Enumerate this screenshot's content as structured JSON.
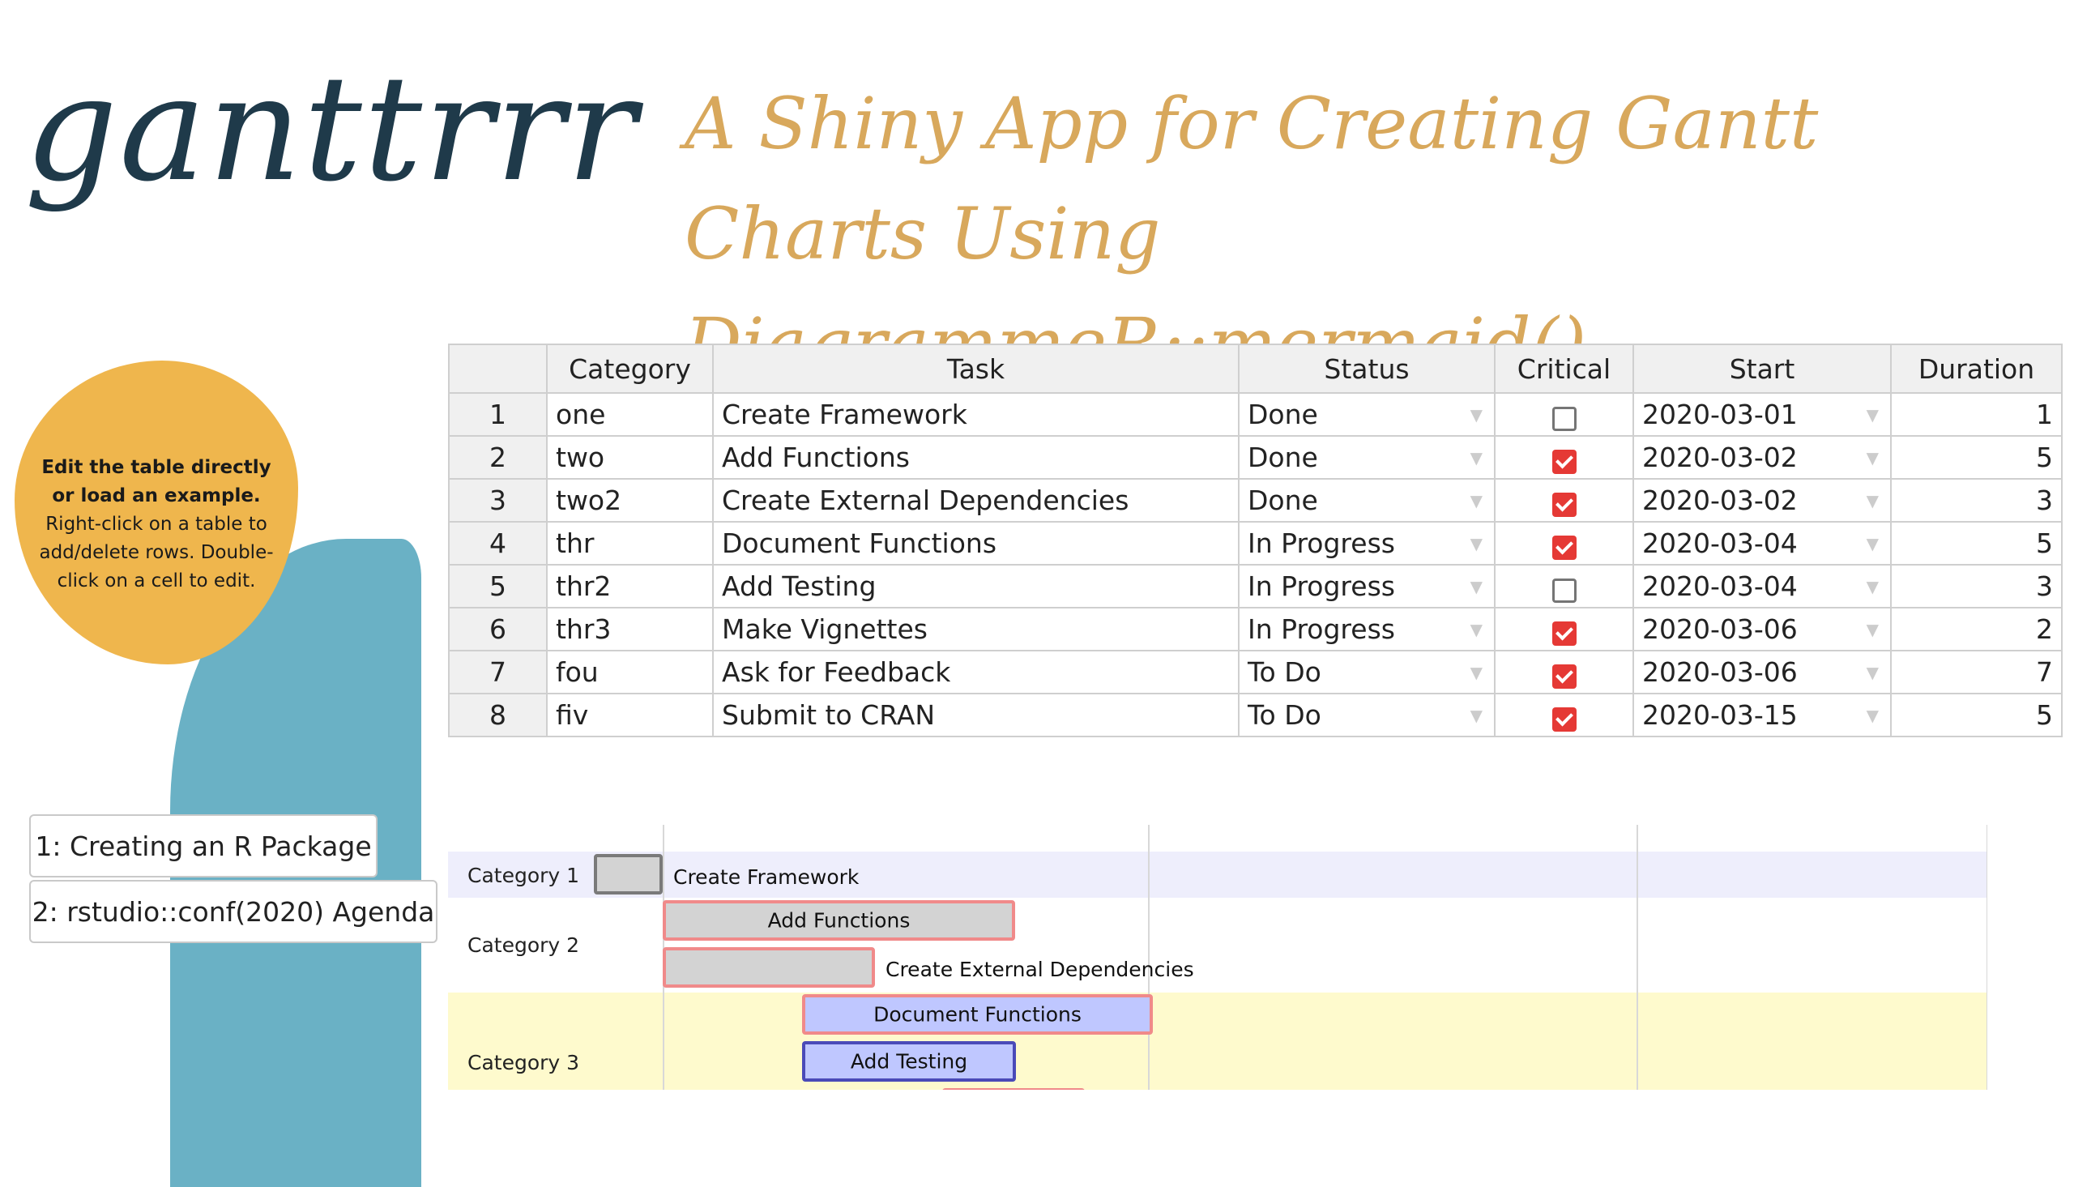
{
  "header": {
    "logo": "ganttrrr",
    "tagline": "A Shiny App for Creating Gantt Charts Using DiagrammeR::mermaid()"
  },
  "sidebar": {
    "help_bold": "Edit the table directly or load an example.",
    "help_text": "Right-click on a table to add/delete rows. Double-click on a cell to edit.",
    "examples": [
      "1: Creating an R Package",
      "2: rstudio::conf(2020) Agenda"
    ]
  },
  "table": {
    "columns": [
      "",
      "Category",
      "Task",
      "Status",
      "Critical",
      "Start",
      "Duration"
    ],
    "rows": [
      {
        "n": "1",
        "category": "one",
        "task": "Create Framework",
        "status": "Done",
        "critical": false,
        "start": "2020-03-01",
        "duration": "1"
      },
      {
        "n": "2",
        "category": "two",
        "task": "Add Functions",
        "status": "Done",
        "critical": true,
        "start": "2020-03-02",
        "duration": "5"
      },
      {
        "n": "3",
        "category": "two2",
        "task": "Create External Dependencies",
        "status": "Done",
        "critical": true,
        "start": "2020-03-02",
        "duration": "3"
      },
      {
        "n": "4",
        "category": "thr",
        "task": "Document Functions",
        "status": "In Progress",
        "critical": true,
        "start": "2020-03-04",
        "duration": "5"
      },
      {
        "n": "5",
        "category": "thr2",
        "task": "Add Testing",
        "status": "In Progress",
        "critical": false,
        "start": "2020-03-04",
        "duration": "3"
      },
      {
        "n": "6",
        "category": "thr3",
        "task": "Make Vignettes",
        "status": "In Progress",
        "critical": true,
        "start": "2020-03-06",
        "duration": "2"
      },
      {
        "n": "7",
        "category": "fou",
        "task": "Ask for Feedback",
        "status": "To Do",
        "critical": true,
        "start": "2020-03-06",
        "duration": "7"
      },
      {
        "n": "8",
        "category": "fiv",
        "task": "Submit to CRAN",
        "status": "To Do",
        "critical": true,
        "start": "2020-03-15",
        "duration": "5"
      }
    ],
    "dropdown_glyph": "▼"
  },
  "gantt": {
    "sections": [
      "Category 1",
      "Category 2",
      "Category 3"
    ],
    "tasks": {
      "create_framework": "Create Framework",
      "add_functions": "Add Functions",
      "create_external": "Create External Dependencies",
      "document_functions": "Document Functions",
      "add_testing": "Add Testing"
    }
  },
  "colors": {
    "logo": "#1f3a4a",
    "tagline": "#d8a85c",
    "yellow_blob": "#efb64d",
    "blue_blob": "#6ab1c5",
    "critical_check": "#e53935",
    "done_bar": "#d3d3d3",
    "active_bar": "#bfc7ff",
    "crit_border": "#f08a8a"
  }
}
